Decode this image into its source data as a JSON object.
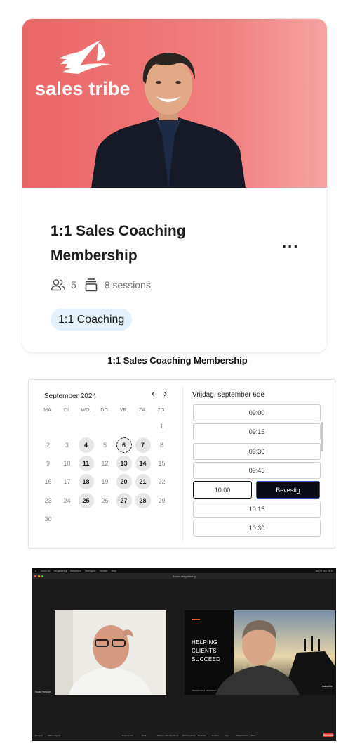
{
  "card": {
    "brand_name": "sales tribe",
    "title": "1:1 Sales Coaching Membership",
    "more_label": "...",
    "member_count": "5",
    "sessions_label": "8 sessions",
    "tag": "1:1 Coaching"
  },
  "calendar_heading": "1:1 Sales Coaching Membership",
  "calendar": {
    "month_label": "September 2024",
    "prev_label": "‹",
    "next_label": "›",
    "weekdays": [
      "MA.",
      "DI.",
      "WO.",
      "DO.",
      "VR.",
      "ZA.",
      "ZO."
    ],
    "days": [
      {
        "label": "",
        "available": false
      },
      {
        "label": "",
        "available": false
      },
      {
        "label": "",
        "available": false
      },
      {
        "label": "",
        "available": false
      },
      {
        "label": "",
        "available": false
      },
      {
        "label": "",
        "available": false
      },
      {
        "label": "1",
        "available": false
      },
      {
        "label": "2",
        "available": false
      },
      {
        "label": "3",
        "available": false
      },
      {
        "label": "4",
        "available": true
      },
      {
        "label": "5",
        "available": false
      },
      {
        "label": "6",
        "available": true,
        "selected": true
      },
      {
        "label": "7",
        "available": true
      },
      {
        "label": "8",
        "available": false
      },
      {
        "label": "9",
        "available": false
      },
      {
        "label": "10",
        "available": false
      },
      {
        "label": "11",
        "available": true
      },
      {
        "label": "12",
        "available": false
      },
      {
        "label": "13",
        "available": true
      },
      {
        "label": "14",
        "available": true
      },
      {
        "label": "15",
        "available": false
      },
      {
        "label": "16",
        "available": false
      },
      {
        "label": "17",
        "available": false
      },
      {
        "label": "18",
        "available": true
      },
      {
        "label": "19",
        "available": false
      },
      {
        "label": "20",
        "available": true
      },
      {
        "label": "21",
        "available": true
      },
      {
        "label": "22",
        "available": false
      },
      {
        "label": "23",
        "available": false
      },
      {
        "label": "24",
        "available": false
      },
      {
        "label": "25",
        "available": true
      },
      {
        "label": "26",
        "available": false
      },
      {
        "label": "27",
        "available": true
      },
      {
        "label": "28",
        "available": true
      },
      {
        "label": "29",
        "available": false
      },
      {
        "label": "30",
        "available": false
      }
    ],
    "selected_date_label": "Vrijdag, september 6de",
    "slots_before": [
      "09:00",
      "09:15",
      "09:30",
      "09:45"
    ],
    "selected_slot": "10:00",
    "confirm_label": "Bevestig",
    "slots_after": [
      "10:15",
      "10:30"
    ]
  },
  "zoom": {
    "window_title": "Zoom-vergadering",
    "mac_menu": [
      "zoom.us",
      "Vergadering",
      "Bewerken",
      "Weergave",
      "Venster",
      "Help"
    ],
    "clock": "wo 25 sep 15:11",
    "left_participant": "Rood Persoon",
    "slide_lines": [
      "HELPING",
      "CLIENTS",
      "SUCCEED"
    ],
    "slide_footer": "TRANSFORM STRATEGY",
    "slide_logo": "salestribe",
    "toolbar_items": [
      "Dempen",
      "Video stoppen",
      "Deelnemers",
      "Chat",
      "Scherm delen",
      "Opnemen",
      "AI Companion",
      "Reacties",
      "Notities",
      "Apps",
      "Whiteboards",
      "Meer"
    ],
    "end_label": "Beëindigen"
  },
  "colors": {
    "hero_coral": "#ea6666",
    "tag_bg": "#e4f1fb",
    "confirm_bg": "#0a0a14",
    "confirm_border": "#2255cc"
  }
}
